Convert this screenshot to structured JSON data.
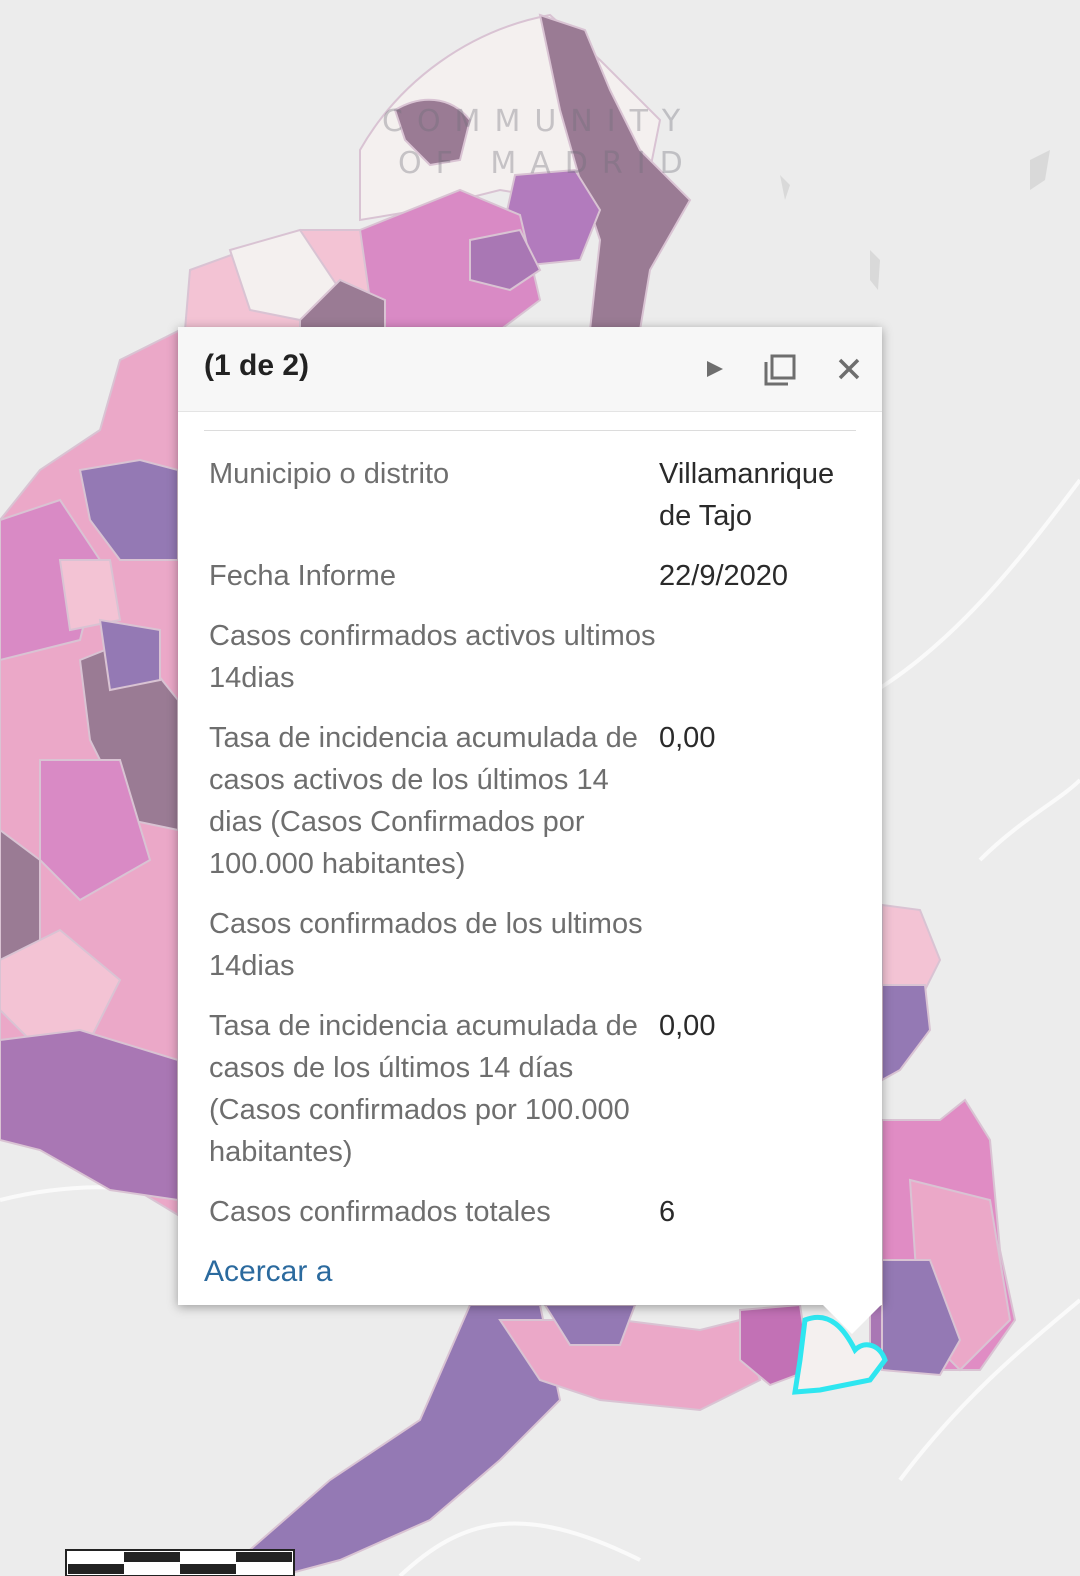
{
  "map": {
    "region_label_line1": "COMMUNITY",
    "region_label_line2": "OF MADRID",
    "colors": {
      "background": "#ececec",
      "darkest": "#9a7b94",
      "purple": "#a977b4",
      "magenta": "#d98ac5",
      "pink": "#eba8c8",
      "light_pink": "#f3c3d4",
      "none": "#f4f0ef",
      "selection": "#2ee6f0"
    }
  },
  "popup": {
    "page_count": "(1 de 2)",
    "icons": {
      "next": "play-next-icon",
      "maximize": "restore-window-icon",
      "close": "close-icon"
    },
    "fields": [
      {
        "name": "Municipio o distrito",
        "value": "Villamanrique de Tajo"
      },
      {
        "name": "Fecha Informe",
        "value": "22/9/2020"
      },
      {
        "name": "Casos confirmados activos ultimos 14dias",
        "value": ""
      },
      {
        "name": "Tasa de incidencia acumulada de casos activos de los últimos 14 dias (Casos Confirmados por 100.000 habitantes)",
        "value": "0,00"
      },
      {
        "name": "Casos confirmados de los ultimos 14dias",
        "value": ""
      },
      {
        "name": "Tasa de incidencia acumulada de casos de los últimos 14 días (Casos confirmados por 100.000 habitantes)",
        "value": "0,00"
      },
      {
        "name": "Casos confirmados totales",
        "value": "6"
      }
    ],
    "zoom_link": "Acercar a",
    "accent_link_color": "#2b6a9e"
  }
}
